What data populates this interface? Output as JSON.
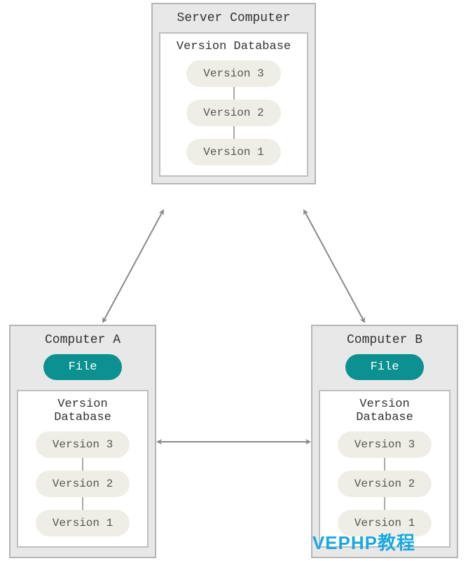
{
  "server": {
    "title": "Server Computer",
    "database": {
      "title": "Version Database",
      "versions": [
        "Version 3",
        "Version 2",
        "Version 1"
      ]
    }
  },
  "computerA": {
    "title": "Computer A",
    "file_label": "File",
    "database": {
      "title": "Version Database",
      "versions": [
        "Version 3",
        "Version 2",
        "Version 1"
      ]
    }
  },
  "computerB": {
    "title": "Computer B",
    "file_label": "File",
    "database": {
      "title": "Version Database",
      "versions": [
        "Version 3",
        "Version 2",
        "Version 1"
      ]
    }
  },
  "watermark": "VEPHP教程",
  "colors": {
    "box_bg": "#e8e8e8",
    "box_border": "#b5b5b5",
    "file_pill": "#0d9090",
    "version_pill": "#efeee6",
    "arrow": "#8a8a8a",
    "watermark": "#1aa8e0"
  }
}
